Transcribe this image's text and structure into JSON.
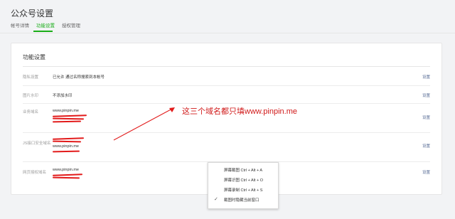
{
  "page": {
    "title": "公众号设置"
  },
  "tabs": [
    {
      "label": "帐号详情"
    },
    {
      "label": "功能设置"
    },
    {
      "label": "授权管理"
    }
  ],
  "accent": "#1aad19",
  "link_color": "#576b95",
  "card": {
    "title": "功能设置",
    "rows": [
      {
        "label": "隐私设置",
        "value": "已允许 通过名称搜索到本帐号",
        "action": "设置"
      },
      {
        "label": "图片水印",
        "value": "不添加水印",
        "action": "设置"
      },
      {
        "label": "业务域名",
        "value": "www.pinpin.me",
        "action": "设置"
      },
      {
        "label": "JS接口安全域名",
        "value": "www.pinpin.me",
        "action": "设置"
      },
      {
        "label": "网页授权域名",
        "value": "www.pinpin.me",
        "action": "设置"
      }
    ]
  },
  "annotation": {
    "text": "这三个域名都只填www.pinpin.me"
  },
  "context_menu": {
    "items": [
      {
        "label": "屏幕截图 Ctrl + Alt + A",
        "checked": false
      },
      {
        "label": "屏幕识图 Ctrl + Alt + O",
        "checked": false
      },
      {
        "label": "屏幕录制 Ctrl + Alt + S",
        "checked": false
      },
      {
        "label": "截图时隐藏当前窗口",
        "checked": true
      }
    ],
    "check_glyph": "✓"
  }
}
